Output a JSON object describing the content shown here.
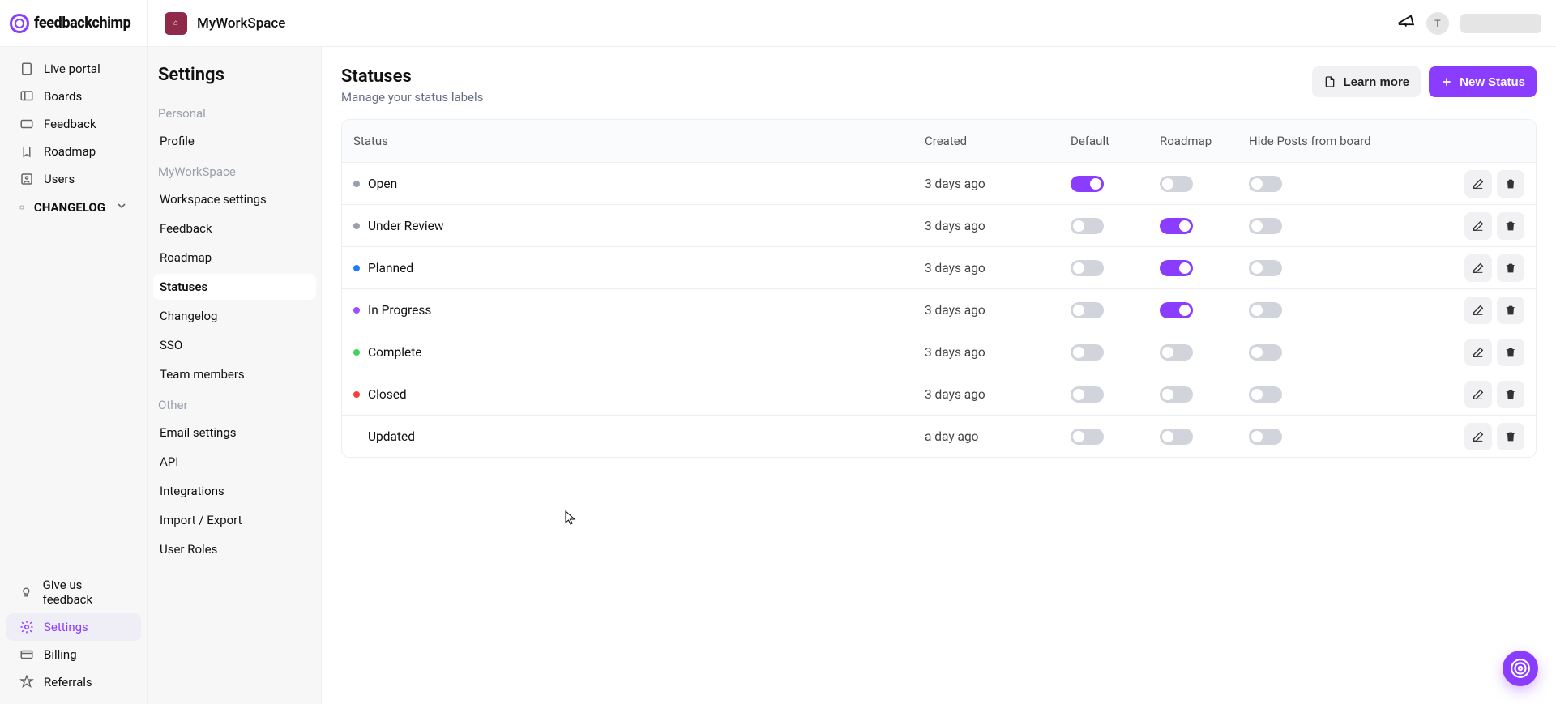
{
  "brand": "feedbackchimp",
  "workspace_name": "MyWorkSpace",
  "avatar_initial": "T",
  "nav_primary": {
    "items": [
      {
        "label": "Live portal"
      },
      {
        "label": "Boards"
      },
      {
        "label": "Feedback"
      },
      {
        "label": "Roadmap"
      },
      {
        "label": "Users"
      },
      {
        "label": "CHANGELOG"
      }
    ],
    "bottom": [
      {
        "label": "Give us feedback"
      },
      {
        "label": "Settings"
      },
      {
        "label": "Billing"
      },
      {
        "label": "Referrals"
      }
    ]
  },
  "settings_sidebar": {
    "title": "Settings",
    "groups": {
      "personal_label": "Personal",
      "personal_items": [
        "Profile"
      ],
      "workspace_label": "MyWorkSpace",
      "workspace_items": [
        "Workspace settings",
        "Feedback",
        "Roadmap",
        "Statuses",
        "Changelog",
        "SSO",
        "Team members"
      ],
      "other_label": "Other",
      "other_items": [
        "Email settings",
        "API",
        "Integrations",
        "Import / Export",
        "User Roles"
      ]
    },
    "active": "Statuses"
  },
  "page": {
    "title": "Statuses",
    "subtitle": "Manage your status labels",
    "learn_more": "Learn more",
    "new_status": "New Status"
  },
  "table": {
    "headers": [
      "Status",
      "Created",
      "Default",
      "Roadmap",
      "Hide Posts from board"
    ],
    "rows": [
      {
        "name": "Open",
        "created": "3 days ago",
        "default": true,
        "roadmap": false,
        "hide": false,
        "dot": "#9aa0ab"
      },
      {
        "name": "Under Review",
        "created": "3 days ago",
        "default": false,
        "roadmap": true,
        "hide": false,
        "dot": "#9aa0ab"
      },
      {
        "name": "Planned",
        "created": "3 days ago",
        "default": false,
        "roadmap": true,
        "hide": false,
        "dot": "#1d7cff"
      },
      {
        "name": "In Progress",
        "created": "3 days ago",
        "default": false,
        "roadmap": true,
        "hide": false,
        "dot": "#a24cff"
      },
      {
        "name": "Complete",
        "created": "3 days ago",
        "default": false,
        "roadmap": false,
        "hide": false,
        "dot": "#3bd65c"
      },
      {
        "name": "Closed",
        "created": "3 days ago",
        "default": false,
        "roadmap": false,
        "hide": false,
        "dot": "#ff3b3b"
      },
      {
        "name": "Updated",
        "created": "a day ago",
        "default": false,
        "roadmap": false,
        "hide": false,
        "dot": ""
      }
    ]
  }
}
